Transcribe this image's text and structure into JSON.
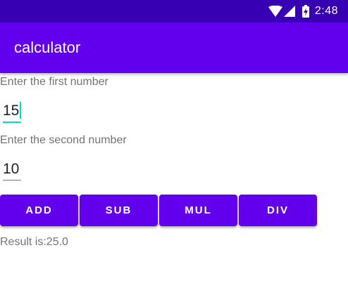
{
  "status_bar": {
    "time": "2:48",
    "icons": [
      "wifi-icon",
      "signal-icon",
      "battery-charging-icon"
    ]
  },
  "app_bar": {
    "title": "calculator"
  },
  "form": {
    "first_label": "Enter the first number",
    "first_value": "15",
    "second_label": "Enter the second number",
    "second_value": "10"
  },
  "buttons": {
    "add": "ADD",
    "sub": "SUB",
    "mul": "MUL",
    "div": "DIV"
  },
  "result": {
    "text": "Result is:25.0"
  },
  "colors": {
    "status_bar": "#3700b3",
    "primary": "#6200ee",
    "accent": "#03dac5",
    "label_text": "#737373"
  }
}
